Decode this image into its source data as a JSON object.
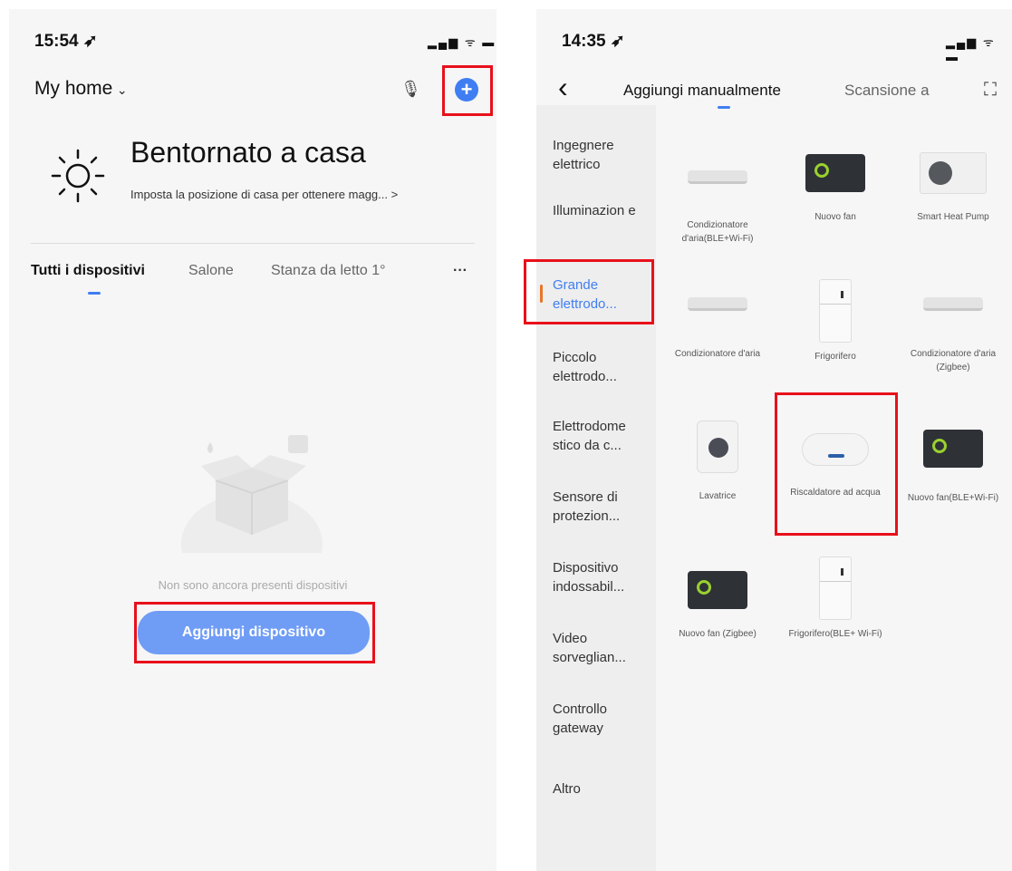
{
  "left": {
    "status": {
      "time": "15:54 ➶",
      "icons": "▂▄▆ ᯤ ▬"
    },
    "header": {
      "home_title": "My home",
      "chevron": "⌄",
      "mic": "🎙",
      "add": "+"
    },
    "welcome": {
      "title": "Bentornato a casa",
      "subtitle": "Imposta la posizione di casa per ottenere magg... >"
    },
    "tabs": [
      {
        "label": "Tutti i dispositivi"
      },
      {
        "label": "Salone"
      },
      {
        "label": "Stanza da letto 1°"
      },
      {
        "label": "···"
      }
    ],
    "empty": {
      "text": "Non sono ancora presenti dispositivi",
      "button": "Aggiungi dispositivo"
    }
  },
  "right": {
    "status": {
      "time": "14:35 ➶",
      "icons": "▂▄▆ ᯤ ▬"
    },
    "header": {
      "back": "‹",
      "tab_manual": "Aggiungi manualmente",
      "tab_scan": "Scansione a",
      "scan_icon": "⛶"
    },
    "sidebar": [
      {
        "label": "Ingegnere elettrico"
      },
      {
        "label": "Illuminazion e"
      },
      {
        "label": "Grande elettrodo..."
      },
      {
        "label": "Piccolo elettrodo..."
      },
      {
        "label": "Elettrodome stico da c..."
      },
      {
        "label": "Sensore di protezion..."
      },
      {
        "label": "Dispositivo indossabil..."
      },
      {
        "label": "Video sorveglian..."
      },
      {
        "label": "Controllo gateway"
      },
      {
        "label": "Altro"
      }
    ],
    "devices": [
      {
        "label": "Condizionatore d'aria(BLE+Wi-Fi)",
        "icon": "ac-unit-icon"
      },
      {
        "label": "Nuovo fan",
        "icon": "fan-icon"
      },
      {
        "label": "Smart Heat Pump",
        "icon": "heat-pump-icon"
      },
      {
        "label": "Condizionatore d'aria",
        "icon": "ac-unit-icon"
      },
      {
        "label": "Frigorifero",
        "icon": "fridge-icon"
      },
      {
        "label": "Condizionatore d'aria (Zigbee)",
        "icon": "ac-unit-icon"
      },
      {
        "label": "Lavatrice",
        "icon": "washer-icon"
      },
      {
        "label": "Riscaldatore ad acqua",
        "icon": "water-heater-icon"
      },
      {
        "label": "Nuovo fan(BLE+Wi-Fi)",
        "icon": "fan-icon"
      },
      {
        "label": "Nuovo fan (Zigbee)",
        "icon": "fan-icon"
      },
      {
        "label": "Frigorifero(BLE+ Wi-Fi)",
        "icon": "fridge-icon"
      }
    ]
  },
  "colors": {
    "accent": "#3f7ef2",
    "highlight": "#e8101b",
    "button": "#6f9cf5"
  }
}
